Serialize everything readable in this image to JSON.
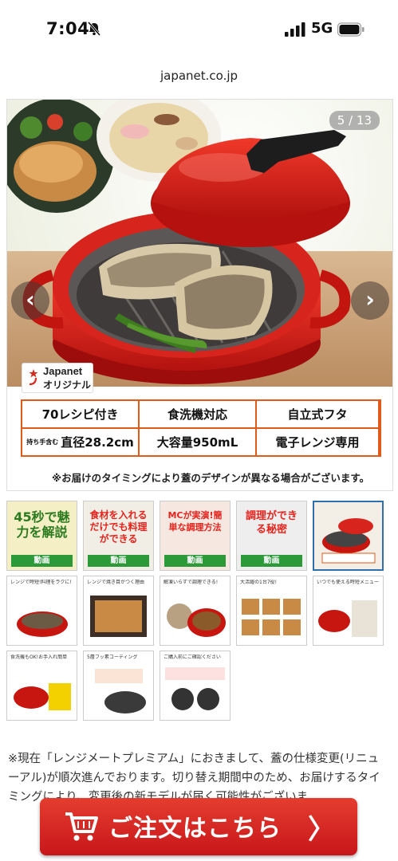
{
  "status_bar": {
    "time": "7:04",
    "network": "5G"
  },
  "browser": {
    "url": "japanet.co.jp"
  },
  "gallery": {
    "counter": "5 / 13",
    "prev_label": "‹",
    "next_label": "›",
    "logo_line1": "Japanet",
    "logo_line2": "オリジナル",
    "specs": {
      "recipes": "70レシピ付き",
      "dishwasher": "食洗機対応",
      "lid": "自立式フタ",
      "diameter_small": "持ち手含む",
      "diameter": "直径28.2cm",
      "capacity": "大容量950mL",
      "microwave": "電子レンジ専用"
    },
    "note": "※お届けのタイミングにより蓋のデザインが異なる場合がございます。"
  },
  "thumbnails": [
    {
      "title": "",
      "big": "45秒で魅力を解説",
      "video": "動画"
    },
    {
      "title": "",
      "big": "食材を入れるだけでも料理ができる",
      "video": "動画"
    },
    {
      "title": "",
      "big": "MCが実演!簡単な調理方法",
      "video": "動画"
    },
    {
      "title": "",
      "big": "調理ができる秘密",
      "video": "動画"
    },
    {
      "title": "",
      "big": "",
      "video": ""
    },
    {
      "title": "レンジで時短!料理をラクに!",
      "big": "",
      "video": ""
    },
    {
      "title": "レンジで焼き目がつく理由",
      "big": "",
      "video": ""
    },
    {
      "title": "解凍いらずで調理できる!",
      "big": "",
      "video": ""
    },
    {
      "title": "大活躍の1台7役!",
      "big": "",
      "video": ""
    },
    {
      "title": "いつでも使える時短メニュー",
      "big": "",
      "video": ""
    },
    {
      "title": "食洗機もOK!お手入れ簡単",
      "big": "",
      "video": ""
    },
    {
      "title": "5層フッ素コーティング",
      "big": "",
      "video": ""
    },
    {
      "title": "ご購入前にご確認ください",
      "big": "",
      "video": ""
    }
  ],
  "description": "※現在「レンジメートプレミアム」におきまして、蓋の仕様変更(リニューアル)が順次進んでおります。切り替え期間中のため、お届けするタイミングにより、変更後の新モデルが届く可能性がございま",
  "order_button": {
    "label": "ご注文はこちら",
    "chevron": "〉"
  },
  "colors": {
    "accent": "#d42a20",
    "spec_border": "#e05a1a",
    "video_green": "#2d9a3a",
    "selected_border": "#2f6fb0"
  }
}
